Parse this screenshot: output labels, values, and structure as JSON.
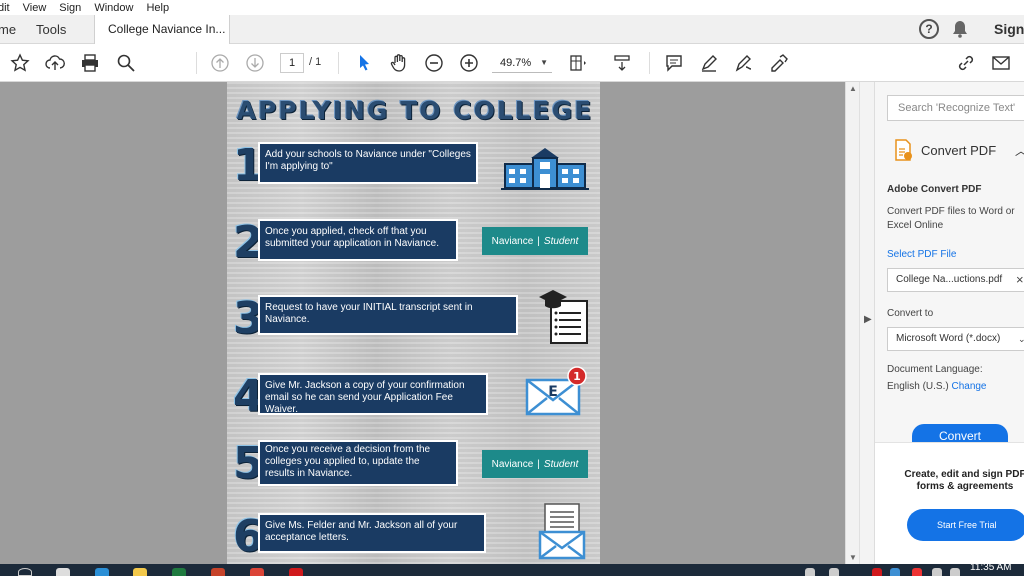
{
  "menubar": {
    "items": [
      "Edit",
      "View",
      "Sign",
      "Window",
      "Help"
    ]
  },
  "tabs": {
    "home": "Home",
    "tools": "Tools",
    "document": "College Naviance In...",
    "sign_in": "Sign In"
  },
  "toolbar": {
    "page_current": "1",
    "page_total": "/ 1",
    "zoom": "49.7%"
  },
  "pdf": {
    "title": "APPLYING TO COLLEGE",
    "steps": [
      {
        "number": "1",
        "text": "Add your schools to Naviance under \"Colleges I'm applying to\"",
        "icon": "school-building-icon"
      },
      {
        "number": "2",
        "text": "Once you applied, check off that you submitted your application in Naviance.",
        "icon": "naviance-logo"
      },
      {
        "number": "3",
        "text": "Request to have your INITIAL transcript sent in Naviance.",
        "icon": "graduation-checklist-icon"
      },
      {
        "number": "4",
        "text": "Give Mr. Jackson a copy of your confirmation email so he can send your Application Fee Waiver.",
        "icon": "email-notification-icon"
      },
      {
        "number": "5",
        "text": "Once you receive a decision from the colleges you applied to, update the results in Naviance.",
        "icon": "naviance-logo"
      },
      {
        "number": "6",
        "text": "Give Ms. Felder and Mr. Jackson all of your acceptance letters.",
        "icon": "letter-envelope-icon"
      }
    ],
    "naviance_name": "Naviance",
    "naviance_sub": "Student",
    "email_badge": "1",
    "email_letter": "E"
  },
  "sidepanel": {
    "search_placeholder": "Search 'Recognize Text'",
    "tool_name": "Convert PDF",
    "heading": "Adobe Convert PDF",
    "description": "Convert PDF files to Word or Excel Online",
    "select_file_link": "Select PDF File",
    "selected_file": "College Na...uctions.pdf",
    "convert_to_label": "Convert to",
    "convert_to_value": "Microsoft Word (*.docx)",
    "doc_language_label": "Document Language:",
    "doc_language_value": "English (U.S.)",
    "change_link": "Change",
    "convert_button": "Convert",
    "promo_text": "Create, edit and sign PDF forms & agreements",
    "trial_button": "Start Free Trial"
  },
  "taskbar": {
    "time": "11:35 AM"
  },
  "colors": {
    "accent": "#1473e6",
    "step_box": "#1a3b63",
    "naviance": "#1d8a8a",
    "viewer_bg": "#9d9d9d"
  }
}
